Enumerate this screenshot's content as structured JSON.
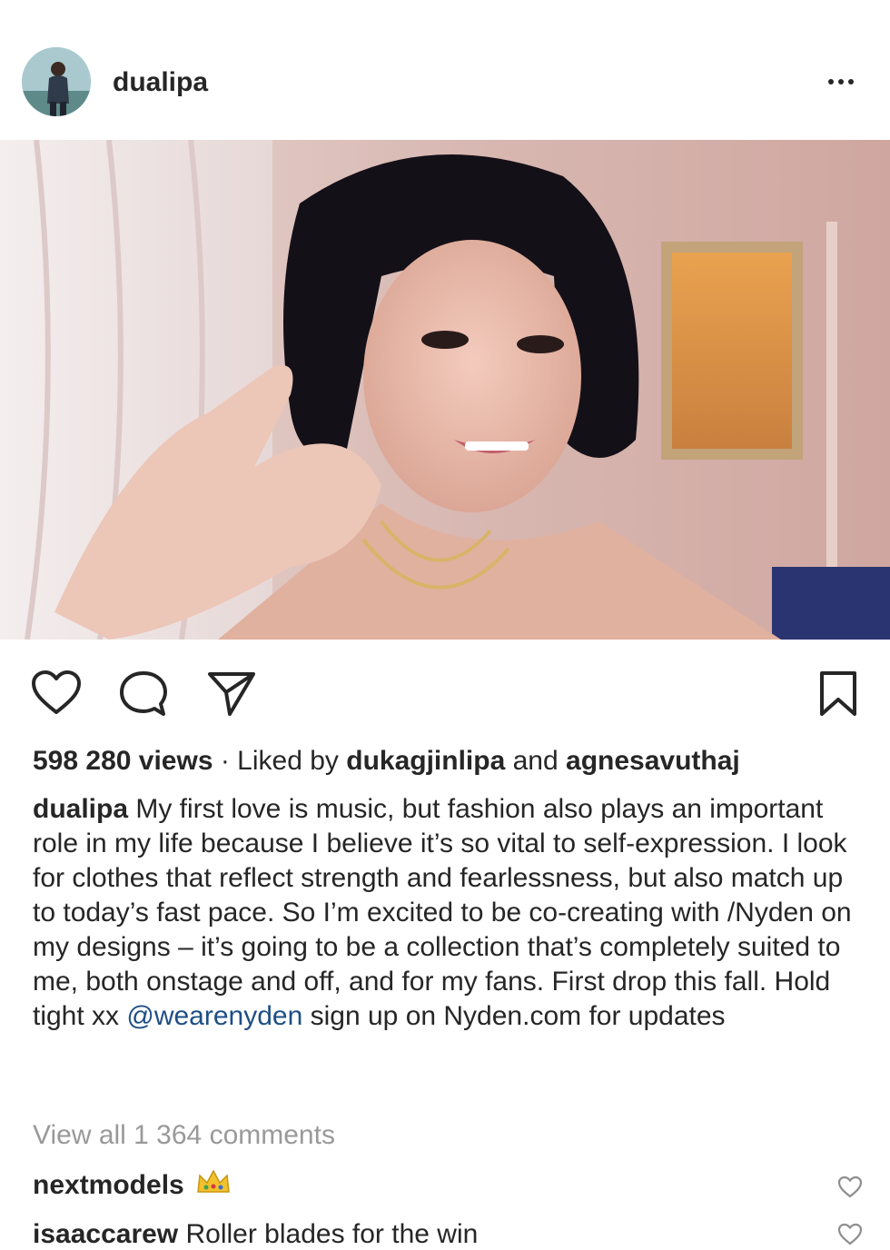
{
  "post": {
    "username": "dualipa",
    "stats": {
      "views": "598 280 views",
      "separator": " · Liked by ",
      "liker1": "dukagjinlipa",
      "and": " and ",
      "liker2": "agnesavuthaj"
    },
    "caption": {
      "username": "dualipa",
      "text_before_mention": " My first love is music, but fashion also plays an important role in my life because I believe it’s so vital to self-expression. I look for clothes that reflect strength and fearlessness, but also match up to today’s fast pace. So I’m excited to be co-creating with /Nyden on my designs – it’s going to be a collection that’s completely suited to me, both onstage and off, and for my fans. First drop this fall. Hold tight xx ",
      "mention": "@wearenyden",
      "text_after_mention": " sign up on Nyden.com for updates"
    },
    "view_all_comments": "View all 1 364 comments",
    "comments": [
      {
        "username": "nextmodels",
        "text": "",
        "emoji": "crown"
      },
      {
        "username": "isaaccarew",
        "text": " Roller blades for the win"
      }
    ]
  },
  "icons": {
    "like": "heart-icon",
    "comment": "comment-bubble-icon",
    "share": "paper-plane-icon",
    "save": "bookmark-icon",
    "more": "more-dots-icon"
  },
  "colors": {
    "text": "#262626",
    "muted": "#999999",
    "mention": "#1e4f85"
  }
}
